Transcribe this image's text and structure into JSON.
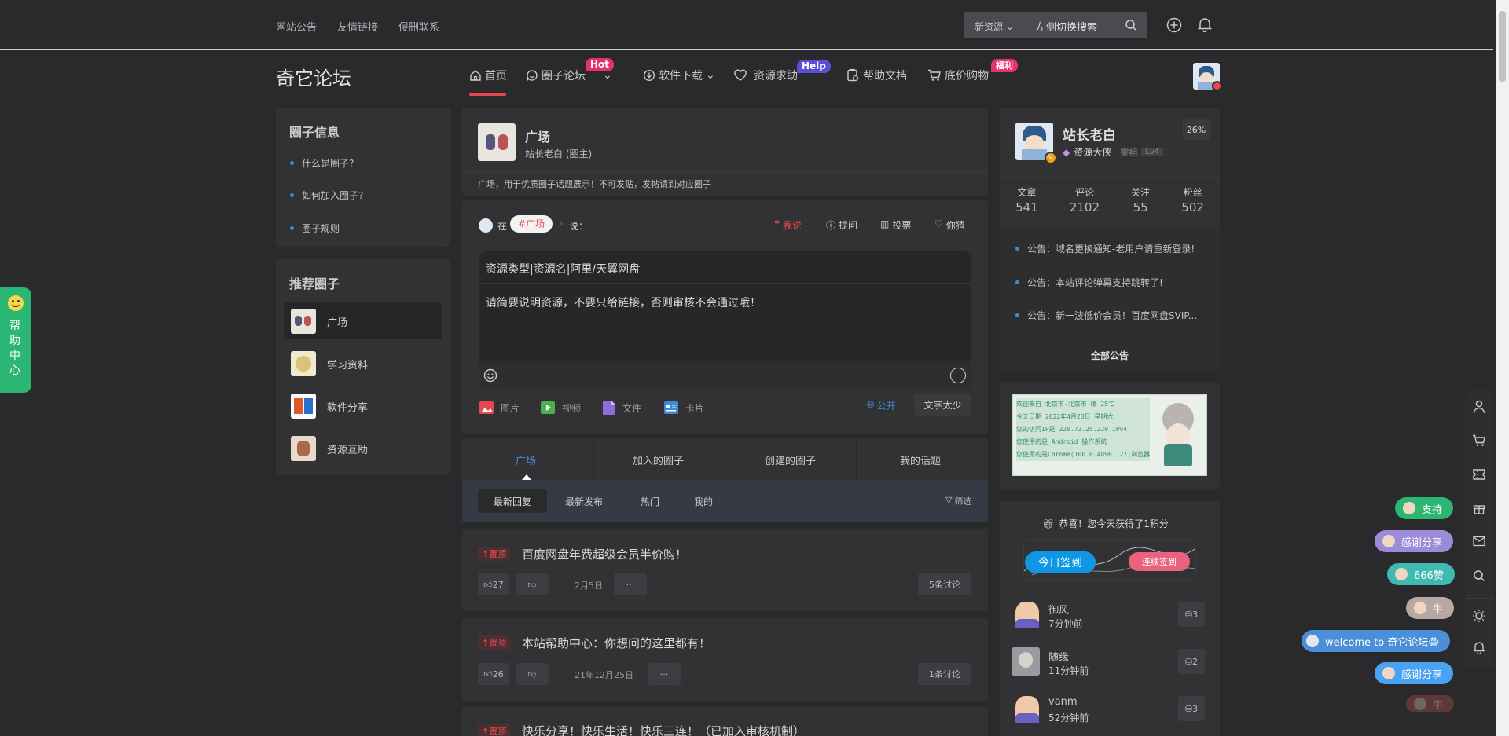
{
  "topbar": {
    "links": [
      "网站公告",
      "友情链接",
      "侵删联系"
    ],
    "search": {
      "scope": "新资源",
      "placeholder": "左侧切换搜索"
    }
  },
  "nav": {
    "logo": "奇它论坛",
    "items": [
      {
        "label": "首页",
        "badge": ""
      },
      {
        "label": "圈子论坛",
        "badge": "Hot",
        "badge_color": "#e6306f"
      },
      {
        "label": "软件下载",
        "badge": ""
      },
      {
        "label": "资源求助",
        "badge": "Help",
        "badge_color": "#5b4fd9"
      },
      {
        "label": "帮助文档",
        "badge": ""
      },
      {
        "label": "底价购物",
        "badge": "福利",
        "badge_color": "#e6306f"
      }
    ]
  },
  "left": {
    "info_title": "圈子信息",
    "info_items": [
      "什么是圈子?",
      "如何加入圈子?",
      "圈子规则"
    ],
    "rec_title": "推荐圈子",
    "rec_items": [
      "广场",
      "学习资料",
      "软件分享",
      "资源互助"
    ]
  },
  "circle": {
    "name": "广场",
    "owner": "站长老白 (圈主)",
    "desc": "广场，用于优质圈子话题展示！不可发贴，发帖请到对应圈子"
  },
  "composer": {
    "in": "在",
    "tag": "#广场",
    "say": "说：",
    "modes": [
      "我说",
      "提问",
      "投票",
      "你猜"
    ],
    "title_placeholder": "资源类型|资源名|阿里/天翼网盘",
    "body_placeholder": "请简要说明资源，不要只给链接，否则审核不会通过哦！",
    "attach": [
      "图片",
      "视频",
      "文件",
      "卡片"
    ],
    "visibility": "公开",
    "submit": "文字太少"
  },
  "tabs": [
    "广场",
    "加入的圈子",
    "创建的圈子",
    "我的话题"
  ],
  "subtabs": [
    "最新回复",
    "最新发布",
    "热门",
    "我的"
  ],
  "filter": "筛选",
  "posts": [
    {
      "pin": "置顶",
      "title": "百度网盘年费超级会员半价购！",
      "likes": "27",
      "date": "2月5日",
      "more": "···",
      "comments": "5条讨论"
    },
    {
      "pin": "置顶",
      "title": "本站帮助中心：你想问的这里都有！",
      "likes": "26",
      "date": "21年12月25日",
      "more": "···",
      "comments": "1条讨论"
    },
    {
      "pin": "置顶",
      "title": "快乐分享！快乐生活！快乐三连！（已加入审核机制）"
    }
  ],
  "profile": {
    "name": "站长老白",
    "title": "资源大侠",
    "rank": "宰相",
    "level": "Lv4",
    "percent": "26%",
    "stats": [
      {
        "label": "文章",
        "value": "541"
      },
      {
        "label": "评论",
        "value": "2102"
      },
      {
        "label": "关注",
        "value": "55"
      },
      {
        "label": "粉丝",
        "value": "502"
      }
    ],
    "notices": [
      "公告：域名更换通知-老用户请重新登录!",
      "公告：本站评论弹幕支持跳转了!",
      "公告：新一波低价会员！百度网盘SVIP..."
    ],
    "all_notices": "全部公告"
  },
  "ipcard": {
    "lines": [
      "欢迎来自 北京市-北京市 晴 25℃",
      "今天日期 2022年4月23日 星期六",
      "您的访问IP是 220.72.25.220 IPv4",
      "您使用的是 Android 操作系统",
      "您使用的是Chrome(100.0.4896.127)浏览器"
    ]
  },
  "checkin": {
    "title": "恭喜！您今天获得了1积分",
    "today": "今日签到",
    "streak": "连续签到",
    "users": [
      {
        "name": "御风",
        "time": "7分钟前",
        "count": "3"
      },
      {
        "name": "随缘",
        "time": "11分钟前",
        "count": "2"
      },
      {
        "name": "vanm",
        "time": "52分钟前",
        "count": "3"
      }
    ]
  },
  "help_tab": "帮助中心",
  "danmaku": [
    {
      "text": "支持",
      "color": "#2bb673"
    },
    {
      "text": "感谢分享",
      "color": "#9b8bd8"
    },
    {
      "text": "666赞",
      "color": "#3fbab0"
    },
    {
      "text": "牛",
      "color": "#b8a8a3"
    },
    {
      "text": "welcome to 奇它论坛😁",
      "color": "#4a8fd8"
    },
    {
      "text": "感谢分享",
      "color": "#4aa3f0"
    },
    {
      "text": "牛",
      "color": "#c0504d"
    }
  ]
}
